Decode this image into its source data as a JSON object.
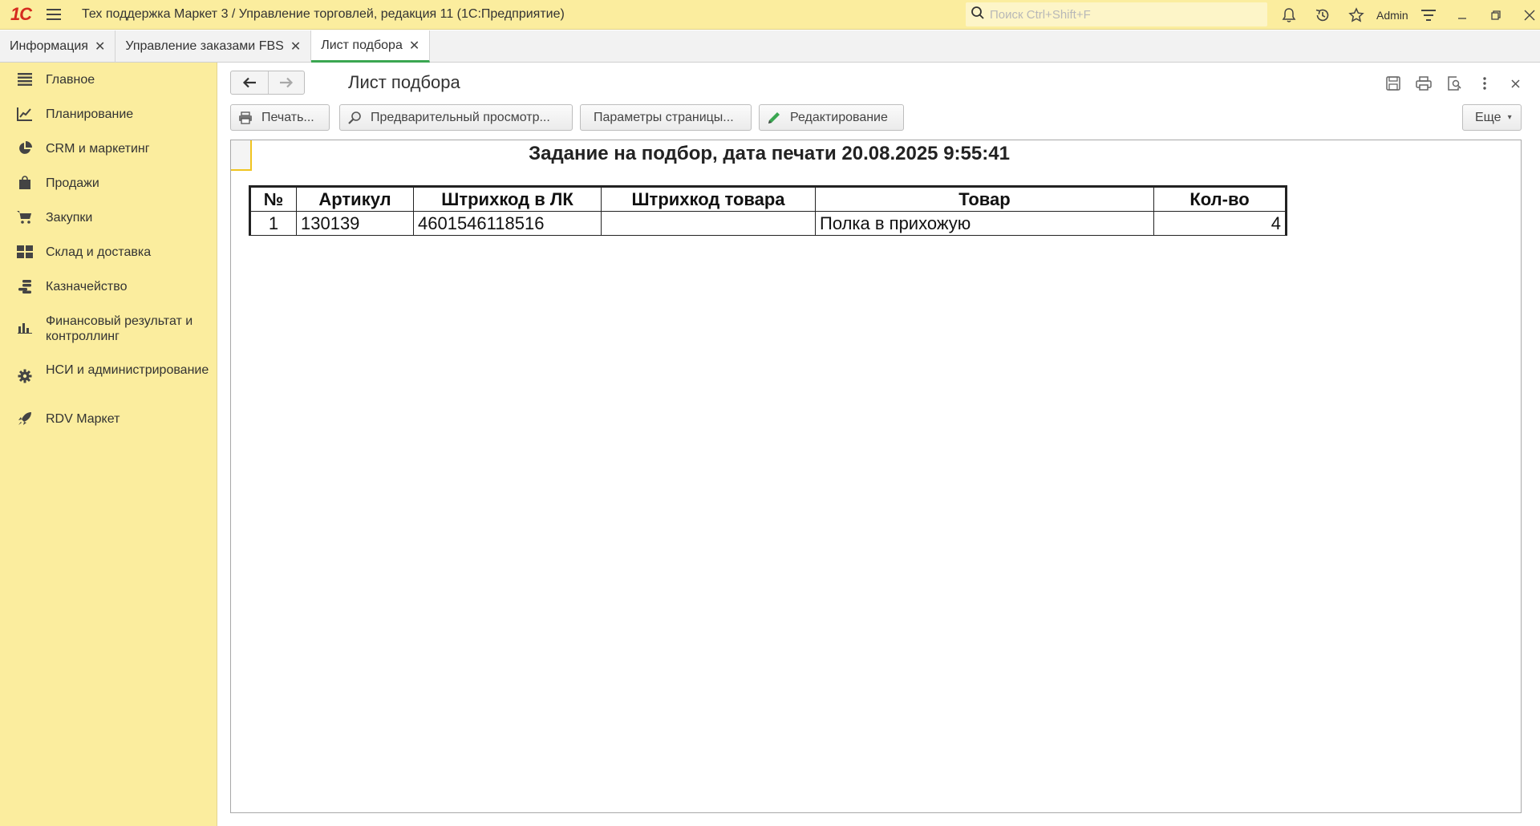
{
  "titlebar": {
    "logo": "1С",
    "title": "Тех поддержка Маркет 3 / Управление торговлей, редакция 11  (1С:Предприятие)",
    "search_placeholder": "Поиск Ctrl+Shift+F",
    "user": "Admin"
  },
  "tabs": [
    {
      "label": "Информация"
    },
    {
      "label": "Управление заказами FBS"
    },
    {
      "label": "Лист подбора"
    }
  ],
  "sidebar": {
    "items": [
      {
        "label": "Главное"
      },
      {
        "label": "Планирование"
      },
      {
        "label": "CRM и маркетинг"
      },
      {
        "label": "Продажи"
      },
      {
        "label": "Закупки"
      },
      {
        "label": "Склад и доставка"
      },
      {
        "label": "Казначейство"
      },
      {
        "label": "Финансовый результат и контроллинг"
      },
      {
        "label": "НСИ и администрирование"
      },
      {
        "label": "RDV Маркет"
      }
    ]
  },
  "form": {
    "title": "Лист подбора",
    "buttons": {
      "print": "Печать...",
      "preview": "Предварительный просмотр...",
      "page_params": "Параметры страницы...",
      "edit": "Редактирование",
      "more": "Еще"
    }
  },
  "document": {
    "title": "Задание на подбор, дата печати 20.08.2025 9:55:41",
    "columns": [
      "№",
      "Артикул",
      "Штрихкод в ЛК",
      "Штрихкод товара",
      "Товар",
      "Кол-во"
    ],
    "rows": [
      [
        "1",
        "130139",
        "4601546118516",
        "",
        "Полка в прихожую",
        "4"
      ]
    ]
  },
  "colors": {
    "panel_yellow": "#fbed9e",
    "active_tab_accent": "#3aa651",
    "logo_red": "#d52b1e"
  }
}
